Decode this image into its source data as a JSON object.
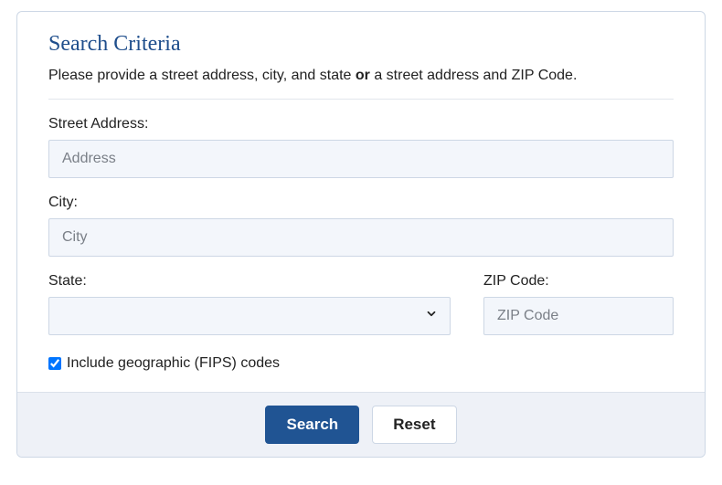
{
  "title": "Search Criteria",
  "instruction_before": "Please provide a street address, city, and state ",
  "instruction_bold": "or",
  "instruction_after": " a street address and ZIP Code.",
  "fields": {
    "street": {
      "label": "Street Address:",
      "placeholder": "Address",
      "value": ""
    },
    "city": {
      "label": "City:",
      "placeholder": "City",
      "value": ""
    },
    "state": {
      "label": "State:",
      "value": ""
    },
    "zip": {
      "label": "ZIP Code:",
      "placeholder": "ZIP Code",
      "value": ""
    }
  },
  "checkbox": {
    "label": "Include geographic (FIPS) codes",
    "checked": true
  },
  "buttons": {
    "search": "Search",
    "reset": "Reset"
  }
}
